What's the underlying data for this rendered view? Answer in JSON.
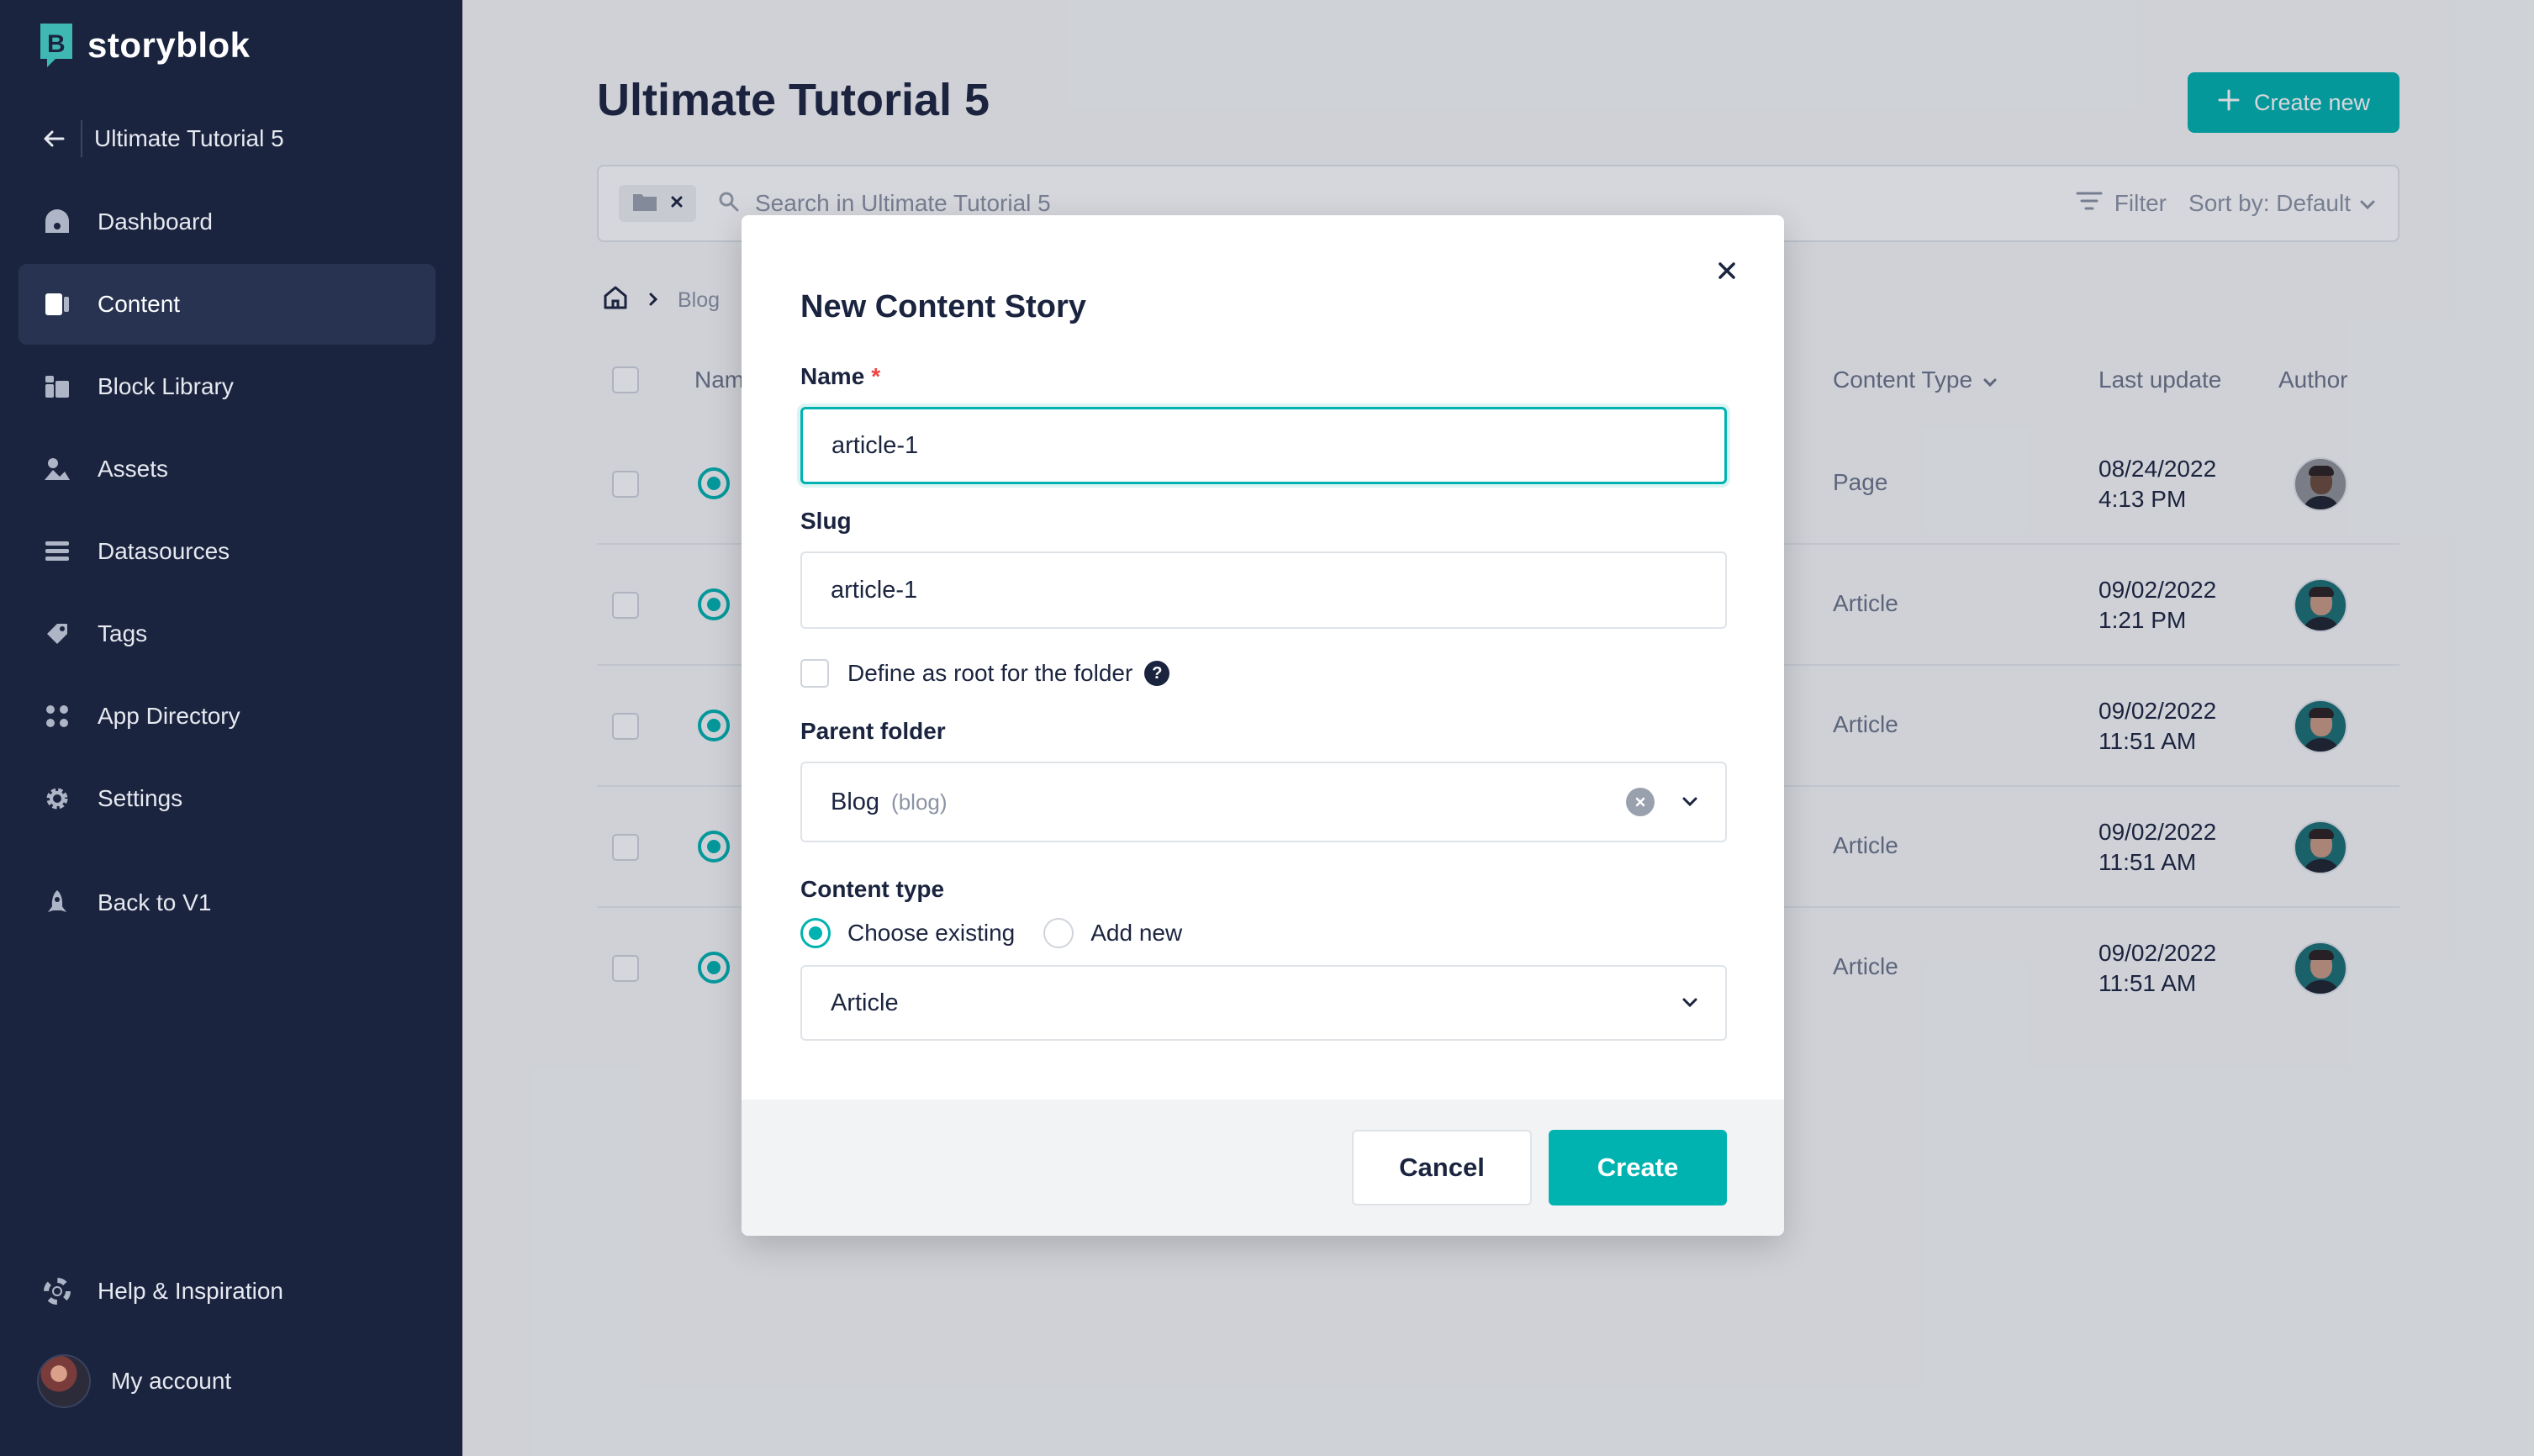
{
  "app": {
    "brand": "storyblok",
    "accent_color": "#00b3b0",
    "sidebar_color": "#1b243f"
  },
  "sidebar": {
    "back_label": "Ultimate Tutorial 5",
    "items": [
      {
        "label": "Dashboard",
        "icon": "dashboard-icon"
      },
      {
        "label": "Content",
        "icon": "content-icon",
        "active": true
      },
      {
        "label": "Block Library",
        "icon": "block-library-icon"
      },
      {
        "label": "Assets",
        "icon": "assets-icon"
      },
      {
        "label": "Datasources",
        "icon": "datasources-icon"
      },
      {
        "label": "Tags",
        "icon": "tags-icon"
      },
      {
        "label": "App Directory",
        "icon": "app-directory-icon"
      },
      {
        "label": "Settings",
        "icon": "gear-icon"
      },
      {
        "label": "Back to V1",
        "icon": "rocket-icon"
      }
    ],
    "help_label": "Help & Inspiration",
    "account_label": "My account"
  },
  "main": {
    "title": "Ultimate Tutorial 5",
    "create_new_label": "Create new",
    "search_placeholder": "Search in Ultimate Tutorial 5",
    "filter_label": "Filter",
    "sort_label": "Sort by: Default",
    "breadcrumb": [
      "Blog"
    ],
    "table": {
      "headers": {
        "name": "Name",
        "content_type": "Content Type",
        "last_update": "Last update",
        "author": "Author"
      },
      "rows": [
        {
          "content_type": "Page",
          "date": "08/24/2022",
          "time": "4:13 PM"
        },
        {
          "content_type": "Article",
          "date": "09/02/2022",
          "time": "1:21 PM"
        },
        {
          "content_type": "Article",
          "date": "09/02/2022",
          "time": "11:51 AM"
        },
        {
          "content_type": "Article",
          "date": "09/02/2022",
          "time": "11:51 AM"
        },
        {
          "content_type": "Article",
          "date": "09/02/2022",
          "time": "11:51 AM"
        }
      ]
    }
  },
  "modal": {
    "title": "New Content Story",
    "name_label": "Name",
    "required_mark": "*",
    "name_value": "article-1",
    "slug_label": "Slug",
    "slug_value": "article-1",
    "root_checkbox_label": "Define as root for the folder",
    "help_glyph": "?",
    "parent_folder_label": "Parent folder",
    "parent_folder_value": "Blog",
    "parent_folder_slug": "(blog)",
    "content_type_label": "Content type",
    "radio_existing": "Choose existing",
    "radio_new": "Add new",
    "content_type_value": "Article",
    "cancel_label": "Cancel",
    "create_label": "Create"
  }
}
